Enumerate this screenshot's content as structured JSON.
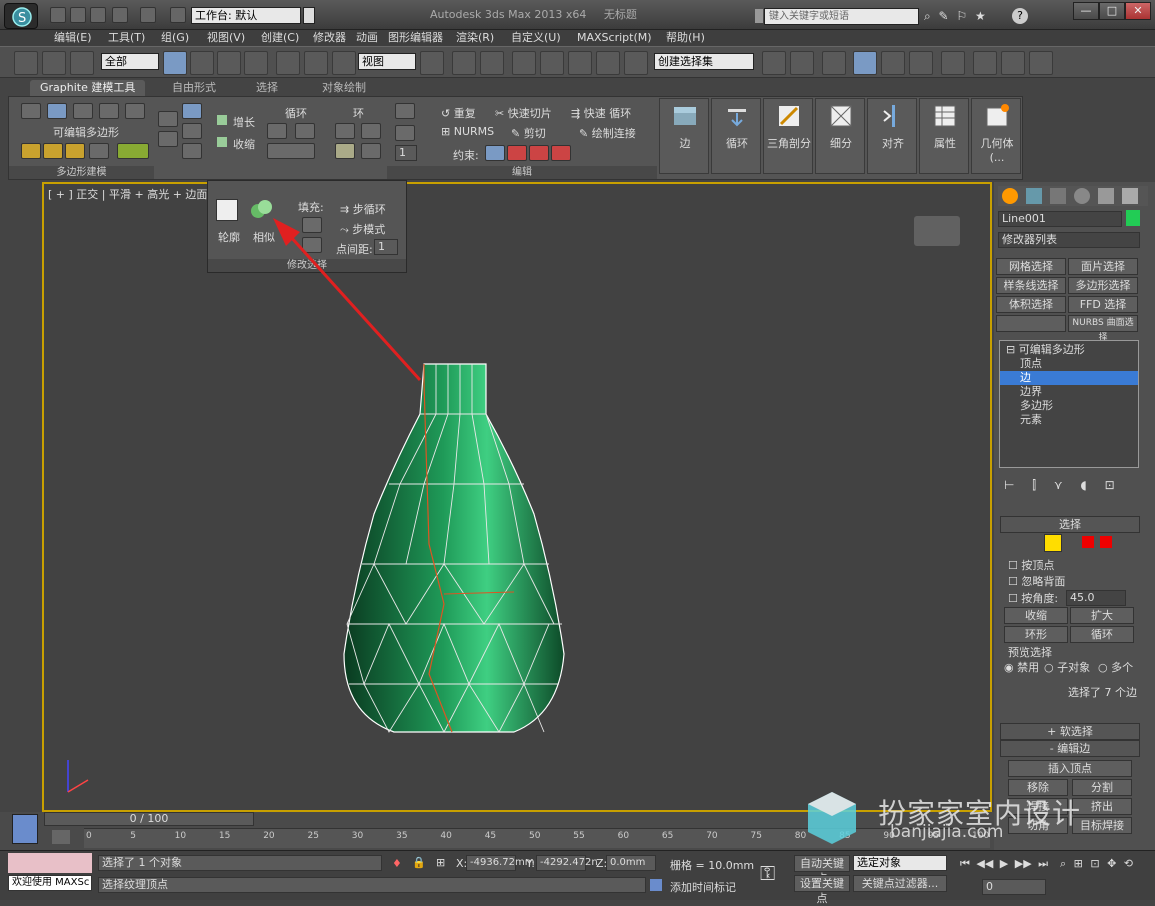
{
  "title": {
    "workspace": "工作台: 默认",
    "app": "Autodesk 3ds Max  2013 x64",
    "doc": "无标题",
    "search_placeholder": "键入关键字或短语"
  },
  "menu": [
    "编辑(E)",
    "工具(T)",
    "组(G)",
    "视图(V)",
    "创建(C)",
    "修改器",
    "动画",
    "图形编辑器",
    "渲染(R)",
    "自定义(U)",
    "MAXScript(M)",
    "帮助(H)"
  ],
  "toolbar": {
    "filter": "全部",
    "refcoord": "视图",
    "named_sel": "创建选择集"
  },
  "ribbon_tabs": [
    "Graphite 建模工具",
    "自由形式",
    "选择",
    "对象绘制"
  ],
  "ribbon": {
    "poly_group": "可编辑多边形",
    "poly_title": "多边形建模",
    "grow": "增长",
    "shrink": "收缩",
    "loop": "循环",
    "ring": "环",
    "repeat": "重复",
    "quickslice": "快速切片",
    "quickloop": "快速 循环",
    "nurms": "NURMS",
    "cut": "剪切",
    "paint_connect": "绘制连接",
    "constraint": "约束:",
    "spin_value": "1",
    "edit_title": "编辑",
    "big": [
      "边",
      "循环",
      "三角剖分",
      "细分",
      "对齐",
      "属性",
      "几何体 (..."
    ]
  },
  "panel": {
    "outline": "轮廓",
    "similar": "相似",
    "fill": "填充:",
    "step_loop": "步循环",
    "step_mode": "步模式",
    "dot_gap": "点间距:",
    "dot_gap_value": "1",
    "title": "修改选择"
  },
  "viewport": {
    "label": "[ + ] 正交 | 平滑 + 高光 + 边面"
  },
  "cmd": {
    "obj_name": "Line001",
    "mod_list": "修改器列表",
    "btns": [
      "网格选择",
      "面片选择",
      "样条线选择",
      "多边形选择",
      "体积选择",
      "FFD 选择",
      "",
      "NURBS 曲面选择"
    ],
    "stack": [
      "可编辑多边形",
      "顶点",
      "边",
      "边界",
      "多边形",
      "元素"
    ],
    "sel_title": "选择",
    "by_vertex": "按顶点",
    "ignore_back": "忽略背面",
    "by_angle": "按角度:",
    "angle_value": "45.0",
    "shrink": "收缩",
    "grow": "扩大",
    "ring": "环形",
    "loop": "循环",
    "preview": "预览选择",
    "disable": "禁用",
    "subobj": "子对象",
    "multi": "多个",
    "status": "选择了 7 个边",
    "soft": "软选择",
    "edit_edges": "编辑边",
    "insert_vertex": "插入顶点",
    "move": "移除",
    "split": "分割",
    "bridge": "挤出",
    "weld": "焊接",
    "chamfer": "切角",
    "target_weld": "目标焊接"
  },
  "timeline": {
    "frame": "0 / 100",
    "ticks": [
      "0",
      "5",
      "10",
      "15",
      "20",
      "25",
      "30",
      "35",
      "40",
      "45",
      "50",
      "55",
      "60",
      "65",
      "70",
      "75",
      "80",
      "85",
      "90",
      "95",
      "100"
    ]
  },
  "status": {
    "welcome": "欢迎使用 MAXSc",
    "line1": "选择了 1 个对象",
    "line2": "选择纹理顶点",
    "x": "-4936.72mm",
    "y": "-4292.472n",
    "z": "0.0mm",
    "grid": "栅格 = 10.0mm",
    "add_tag": "添加时间标记",
    "autokey": "自动关键点",
    "selected": "选定对象",
    "setkey": "设置关键点",
    "keyfilter": "关键点过滤器...",
    "frame": "0"
  },
  "watermark": {
    "text": "扮家家室内设计",
    "url": "banjiajia.com"
  }
}
